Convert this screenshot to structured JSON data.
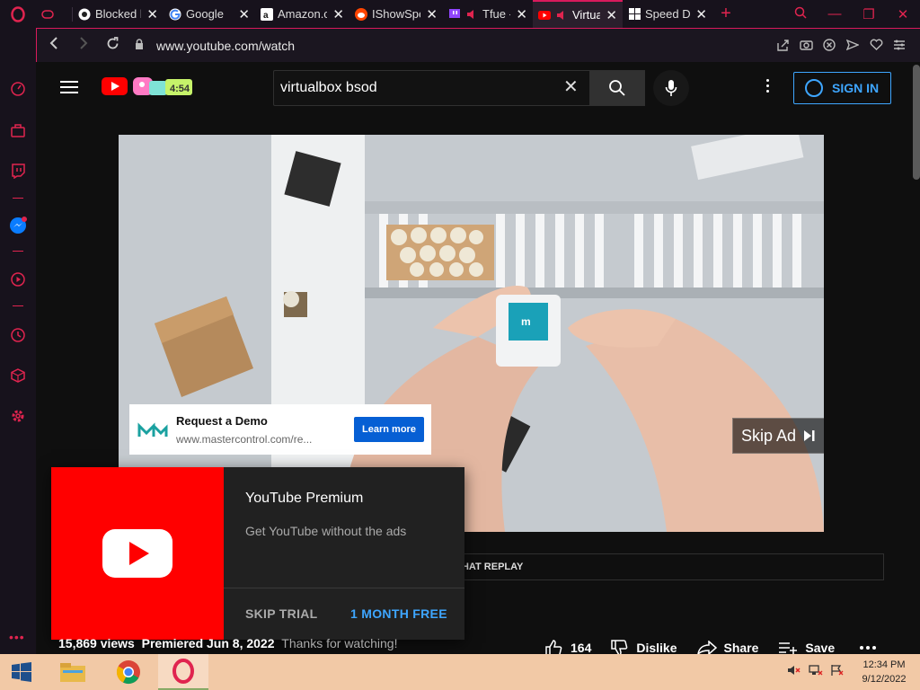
{
  "browser": {
    "tabs": [
      {
        "label": "",
        "favicon": "gamepad-icon",
        "active": false
      },
      {
        "label": "Blocked l",
        "favicon": "globe-icon",
        "active": false
      },
      {
        "label": "Google",
        "favicon": "google-icon",
        "active": false
      },
      {
        "label": "Amazon.c",
        "favicon": "amazon-icon",
        "active": false
      },
      {
        "label": "IShowSpe",
        "favicon": "reddit-icon",
        "active": false
      },
      {
        "label": "Tfue -",
        "favicon": "twitch-icon",
        "active": false
      },
      {
        "label": "Virtua",
        "favicon": "youtube-icon",
        "active": true
      },
      {
        "label": "Speed Di",
        "favicon": "grid-icon",
        "active": false
      }
    ],
    "url": "www.youtube.com/watch",
    "accent": "#d91a5c"
  },
  "youtube": {
    "search_query": "virtualbox bsod",
    "sign_in": "SIGN IN",
    "ad": {
      "title": "Request a Demo",
      "url": "www.mastercontrol.com/re...",
      "cta": "Learn more",
      "skip": "Skip Ad",
      "progress": 0.05
    },
    "chat_replay": "CHAT REPLAY",
    "premium": {
      "title": "YouTube Premium",
      "subtitle": "Get YouTube without the ads",
      "skip": "SKIP TRIAL",
      "free": "1 MONTH FREE"
    },
    "meta": {
      "views": "15,869 views",
      "premiered": "Premiered Jun 8, 2022",
      "description": "Thanks for watching!"
    },
    "actions": {
      "likes": "164",
      "dislike": "Dislike",
      "share": "Share",
      "save": "Save"
    }
  },
  "taskbar": {
    "time": "12:34 PM",
    "date": "9/12/2022"
  }
}
